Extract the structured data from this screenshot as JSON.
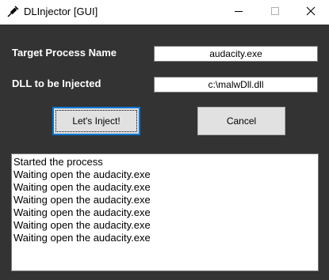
{
  "window": {
    "title": "DLInjector [GUI]"
  },
  "form": {
    "process_label": "Target Process Name",
    "process_value": "audacity.exe",
    "dll_label": "DLL to be Injected",
    "dll_value": "c:\\malwDll.dll"
  },
  "buttons": {
    "inject_label": "Let's Inject!",
    "cancel_label": "Cancel"
  },
  "log": {
    "lines": [
      "Started the process",
      "Waiting open the audacity.exe",
      "Waiting open the audacity.exe",
      "Waiting open the audacity.exe",
      "Waiting open the audacity.exe",
      "Waiting open the audacity.exe",
      "Waiting open the audacity.exe"
    ]
  },
  "icons": {
    "app": "syringe-icon",
    "minimize": "minimize-icon",
    "maximize": "maximize-icon",
    "close": "close-icon"
  },
  "colors": {
    "window_bg": "#333333",
    "focus_border": "#0078d7",
    "button_bg": "#e1e1e1"
  }
}
